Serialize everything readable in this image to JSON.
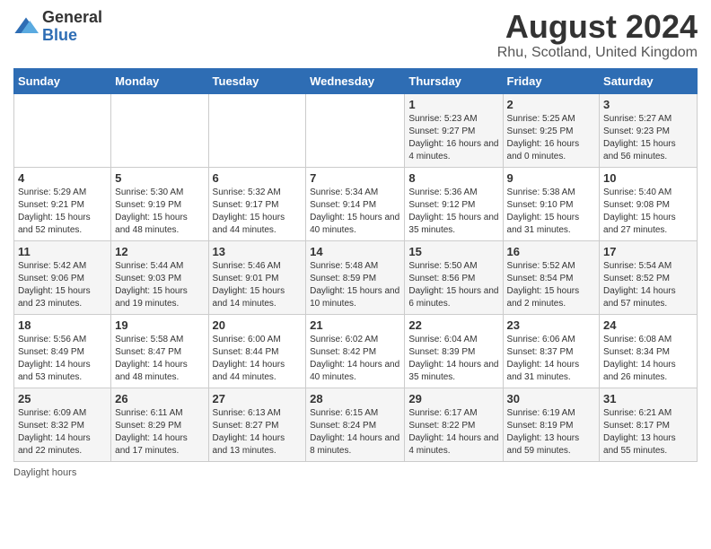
{
  "header": {
    "logo_line1": "General",
    "logo_line2": "Blue",
    "main_title": "August 2024",
    "subtitle": "Rhu, Scotland, United Kingdom"
  },
  "days_of_week": [
    "Sunday",
    "Monday",
    "Tuesday",
    "Wednesday",
    "Thursday",
    "Friday",
    "Saturday"
  ],
  "weeks": [
    [
      {
        "day": "",
        "info": ""
      },
      {
        "day": "",
        "info": ""
      },
      {
        "day": "",
        "info": ""
      },
      {
        "day": "",
        "info": ""
      },
      {
        "day": "1",
        "info": "Sunrise: 5:23 AM\nSunset: 9:27 PM\nDaylight: 16 hours and 4 minutes."
      },
      {
        "day": "2",
        "info": "Sunrise: 5:25 AM\nSunset: 9:25 PM\nDaylight: 16 hours and 0 minutes."
      },
      {
        "day": "3",
        "info": "Sunrise: 5:27 AM\nSunset: 9:23 PM\nDaylight: 15 hours and 56 minutes."
      }
    ],
    [
      {
        "day": "4",
        "info": "Sunrise: 5:29 AM\nSunset: 9:21 PM\nDaylight: 15 hours and 52 minutes."
      },
      {
        "day": "5",
        "info": "Sunrise: 5:30 AM\nSunset: 9:19 PM\nDaylight: 15 hours and 48 minutes."
      },
      {
        "day": "6",
        "info": "Sunrise: 5:32 AM\nSunset: 9:17 PM\nDaylight: 15 hours and 44 minutes."
      },
      {
        "day": "7",
        "info": "Sunrise: 5:34 AM\nSunset: 9:14 PM\nDaylight: 15 hours and 40 minutes."
      },
      {
        "day": "8",
        "info": "Sunrise: 5:36 AM\nSunset: 9:12 PM\nDaylight: 15 hours and 35 minutes."
      },
      {
        "day": "9",
        "info": "Sunrise: 5:38 AM\nSunset: 9:10 PM\nDaylight: 15 hours and 31 minutes."
      },
      {
        "day": "10",
        "info": "Sunrise: 5:40 AM\nSunset: 9:08 PM\nDaylight: 15 hours and 27 minutes."
      }
    ],
    [
      {
        "day": "11",
        "info": "Sunrise: 5:42 AM\nSunset: 9:06 PM\nDaylight: 15 hours and 23 minutes."
      },
      {
        "day": "12",
        "info": "Sunrise: 5:44 AM\nSunset: 9:03 PM\nDaylight: 15 hours and 19 minutes."
      },
      {
        "day": "13",
        "info": "Sunrise: 5:46 AM\nSunset: 9:01 PM\nDaylight: 15 hours and 14 minutes."
      },
      {
        "day": "14",
        "info": "Sunrise: 5:48 AM\nSunset: 8:59 PM\nDaylight: 15 hours and 10 minutes."
      },
      {
        "day": "15",
        "info": "Sunrise: 5:50 AM\nSunset: 8:56 PM\nDaylight: 15 hours and 6 minutes."
      },
      {
        "day": "16",
        "info": "Sunrise: 5:52 AM\nSunset: 8:54 PM\nDaylight: 15 hours and 2 minutes."
      },
      {
        "day": "17",
        "info": "Sunrise: 5:54 AM\nSunset: 8:52 PM\nDaylight: 14 hours and 57 minutes."
      }
    ],
    [
      {
        "day": "18",
        "info": "Sunrise: 5:56 AM\nSunset: 8:49 PM\nDaylight: 14 hours and 53 minutes."
      },
      {
        "day": "19",
        "info": "Sunrise: 5:58 AM\nSunset: 8:47 PM\nDaylight: 14 hours and 48 minutes."
      },
      {
        "day": "20",
        "info": "Sunrise: 6:00 AM\nSunset: 8:44 PM\nDaylight: 14 hours and 44 minutes."
      },
      {
        "day": "21",
        "info": "Sunrise: 6:02 AM\nSunset: 8:42 PM\nDaylight: 14 hours and 40 minutes."
      },
      {
        "day": "22",
        "info": "Sunrise: 6:04 AM\nSunset: 8:39 PM\nDaylight: 14 hours and 35 minutes."
      },
      {
        "day": "23",
        "info": "Sunrise: 6:06 AM\nSunset: 8:37 PM\nDaylight: 14 hours and 31 minutes."
      },
      {
        "day": "24",
        "info": "Sunrise: 6:08 AM\nSunset: 8:34 PM\nDaylight: 14 hours and 26 minutes."
      }
    ],
    [
      {
        "day": "25",
        "info": "Sunrise: 6:09 AM\nSunset: 8:32 PM\nDaylight: 14 hours and 22 minutes."
      },
      {
        "day": "26",
        "info": "Sunrise: 6:11 AM\nSunset: 8:29 PM\nDaylight: 14 hours and 17 minutes."
      },
      {
        "day": "27",
        "info": "Sunrise: 6:13 AM\nSunset: 8:27 PM\nDaylight: 14 hours and 13 minutes."
      },
      {
        "day": "28",
        "info": "Sunrise: 6:15 AM\nSunset: 8:24 PM\nDaylight: 14 hours and 8 minutes."
      },
      {
        "day": "29",
        "info": "Sunrise: 6:17 AM\nSunset: 8:22 PM\nDaylight: 14 hours and 4 minutes."
      },
      {
        "day": "30",
        "info": "Sunrise: 6:19 AM\nSunset: 8:19 PM\nDaylight: 13 hours and 59 minutes."
      },
      {
        "day": "31",
        "info": "Sunrise: 6:21 AM\nSunset: 8:17 PM\nDaylight: 13 hours and 55 minutes."
      }
    ]
  ],
  "footer": {
    "daylight_label": "Daylight hours"
  }
}
